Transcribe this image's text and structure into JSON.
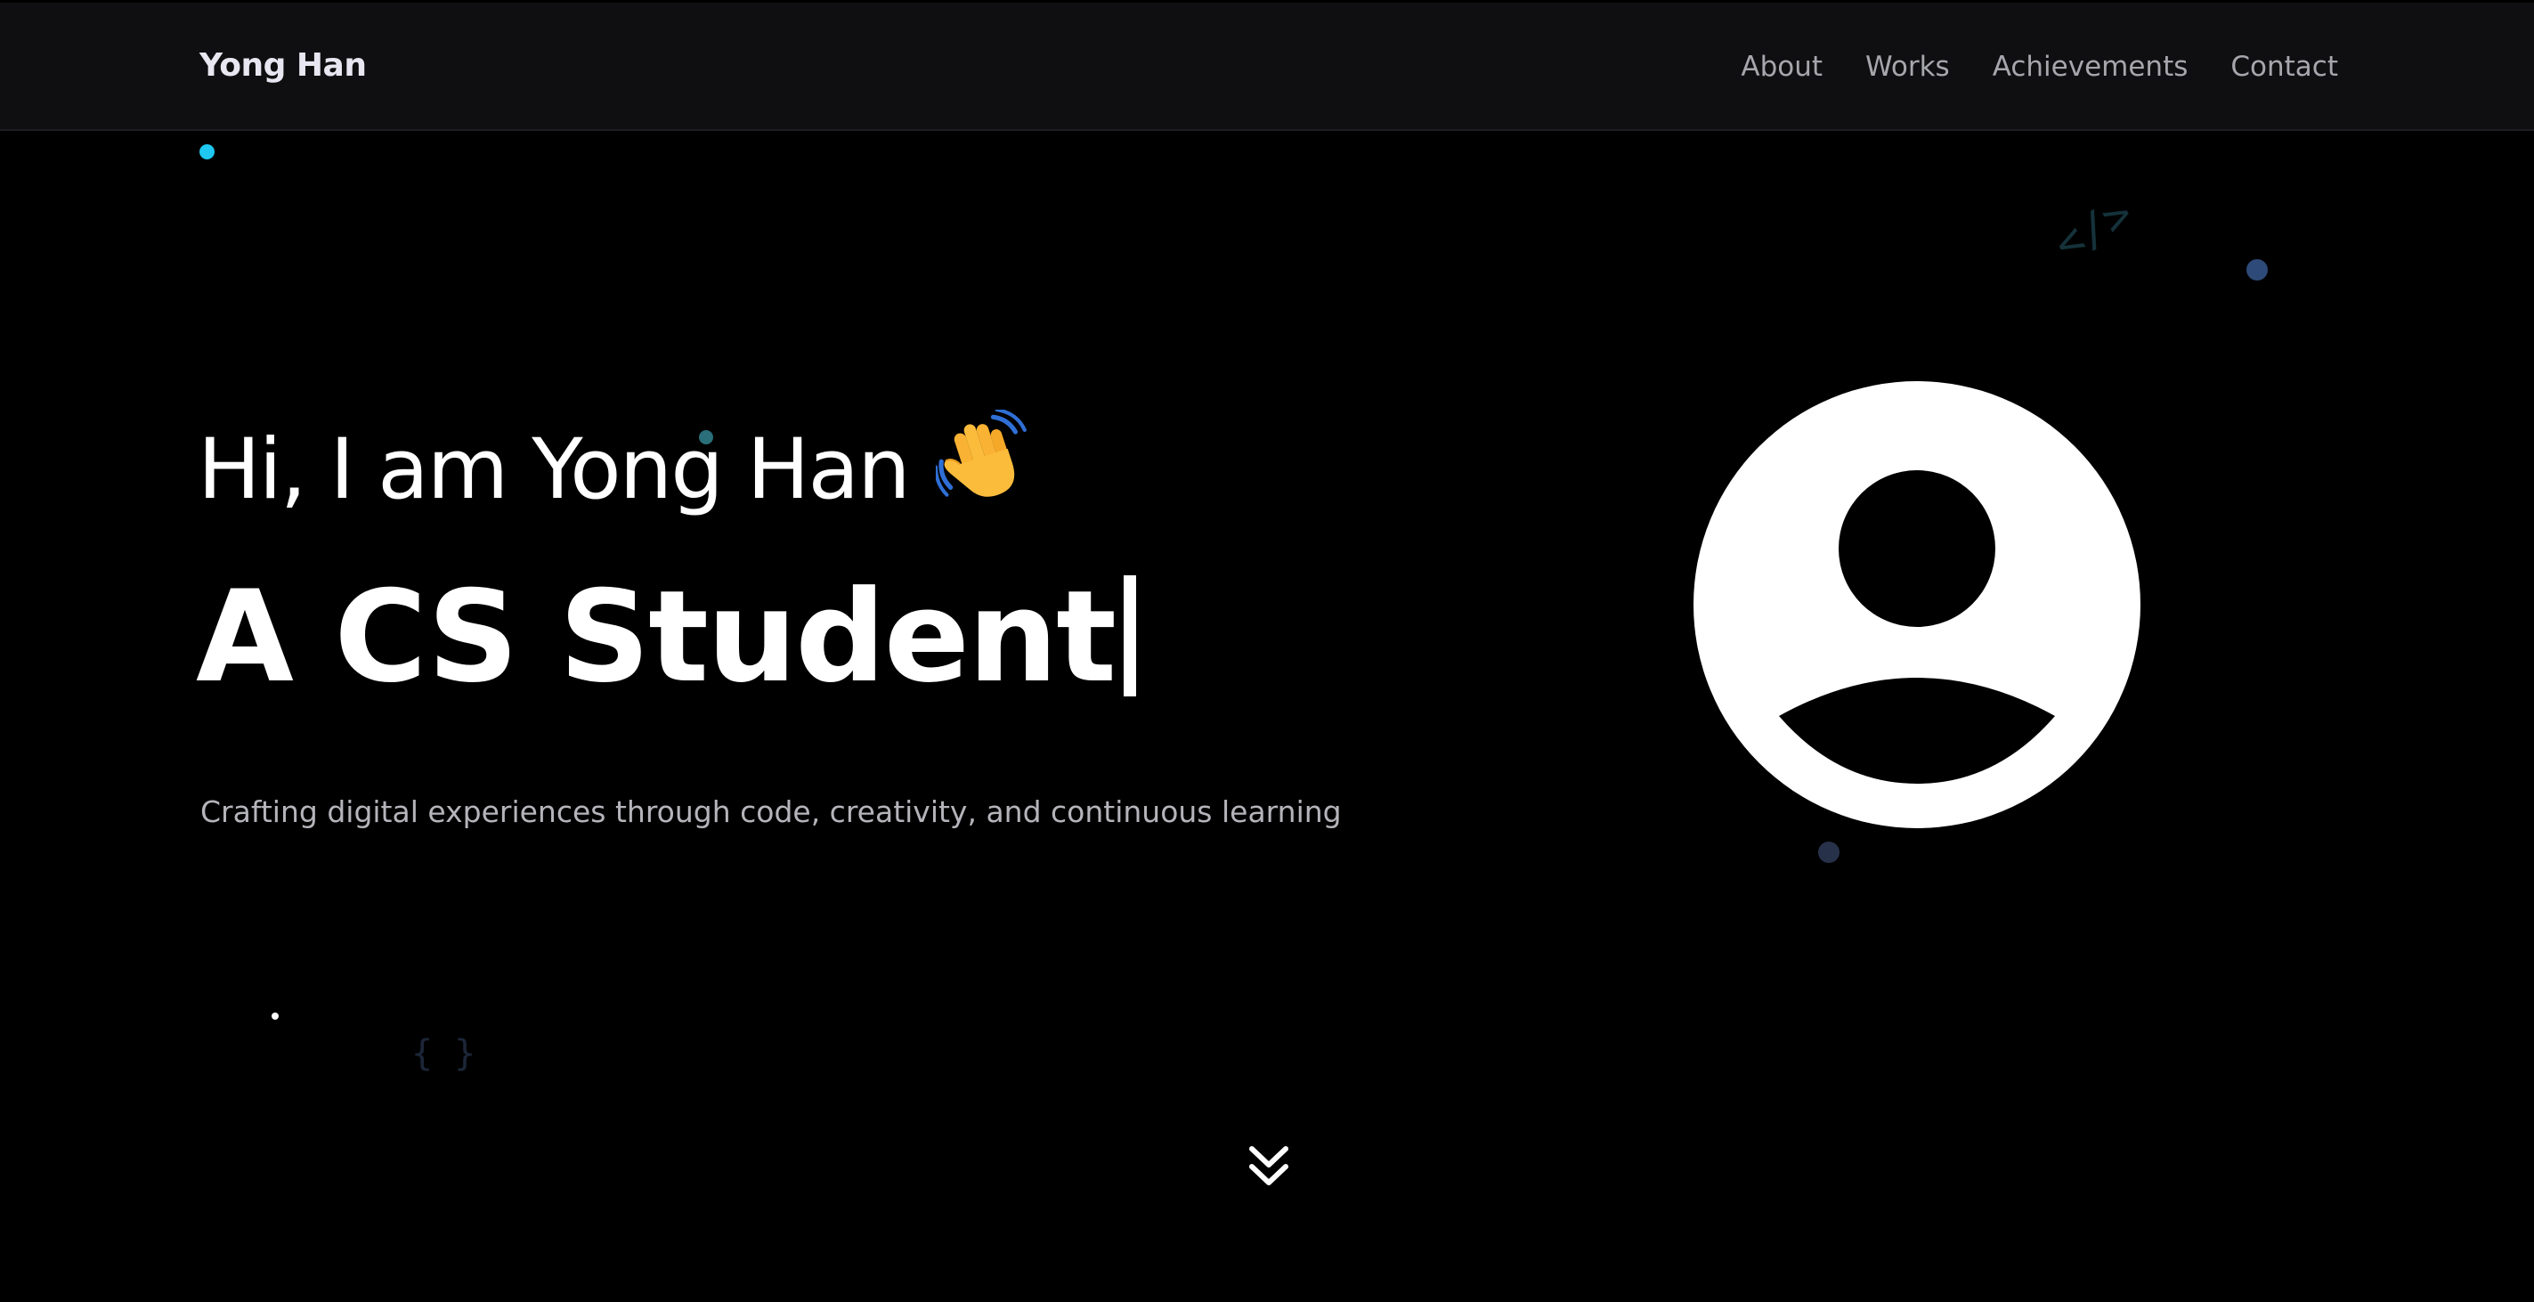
{
  "nav": {
    "brand": "Yong Han",
    "links": [
      {
        "label": "About"
      },
      {
        "label": "Works"
      },
      {
        "label": "Achievements"
      },
      {
        "label": "Contact"
      }
    ]
  },
  "hero": {
    "greeting": "Hi, I am Yong Han",
    "greeting_emoji": "waving-hand-icon",
    "headline": "A CS Student",
    "subtitle": "Crafting digital experiences through code, creativity, and continuous learning"
  },
  "decor": {
    "code_tag": "</>",
    "braces": "{ }"
  },
  "colors": {
    "background": "#000000",
    "navbar_bg": "#0f0f11",
    "accent_cyan": "#1ec8f0",
    "accent_blue": "#2e4a78",
    "text_primary": "#ffffff",
    "text_muted": "#a6a6ad"
  },
  "icons": {
    "profile": "user-avatar-icon",
    "scroll": "double-chevron-down-icon"
  }
}
